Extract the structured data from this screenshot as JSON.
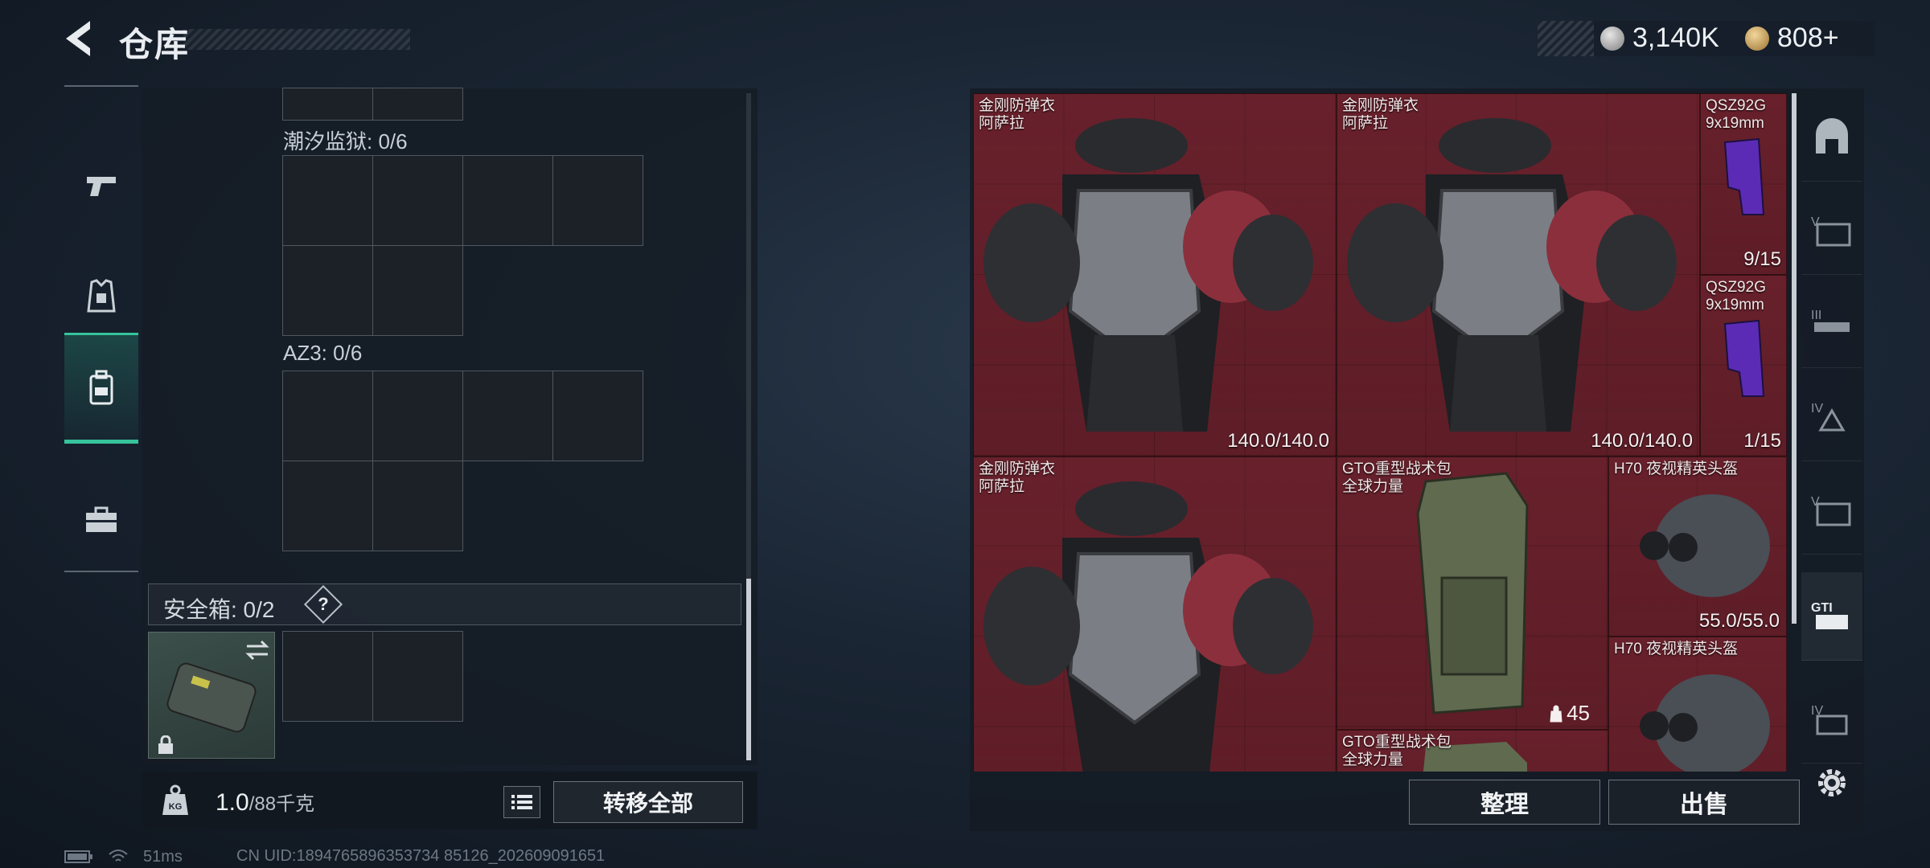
{
  "header": {
    "title": "仓库",
    "currency": {
      "silver": "3,140K",
      "gold": "808",
      "gold_plus": "+"
    }
  },
  "categories": [
    {
      "name": "weapon",
      "icon": "pistol-icon",
      "selected": false
    },
    {
      "name": "armor",
      "icon": "vest-icon",
      "selected": false
    },
    {
      "name": "backpack",
      "icon": "backpack-icon",
      "selected": true
    },
    {
      "name": "tools",
      "icon": "toolbox-icon",
      "selected": false
    }
  ],
  "left_panel": {
    "sections": [
      {
        "label": "潮汐监狱: 0/6"
      },
      {
        "label": "AZ3: 0/6"
      }
    ],
    "safebox": {
      "label": "安全箱: 0/2",
      "help": "?"
    },
    "weight": {
      "current": "1.0",
      "capacity": "/88千克"
    },
    "transfer_all": "转移全部"
  },
  "status": {
    "ping": "51ms",
    "uid": "CN UID:1894765896353734 85126_202609091651"
  },
  "stash_items": [
    {
      "name_line1": "金刚防弹衣",
      "name_line2": "阿萨拉",
      "durability": "140.0/140.0",
      "icon": "body-armor-icon"
    },
    {
      "name_line1": "金刚防弹衣",
      "name_line2": "阿萨拉",
      "durability": "140.0/140.0",
      "icon": "body-armor-icon"
    },
    {
      "name_line1": "QSZ92G",
      "name_line2": "9x19mm",
      "count": "9/15",
      "icon": "ammo-magazine-icon"
    },
    {
      "name_line1": "QSZ92G",
      "name_line2": "9x19mm",
      "count": "1/15",
      "icon": "ammo-magazine-icon"
    },
    {
      "name_line1": "金刚防弹衣",
      "name_line2": "阿萨拉",
      "icon": "body-armor-icon"
    },
    {
      "name_line1": "GTO重型战术包",
      "name_line2": "全球力量",
      "capacity": "45",
      "icon": "backpack-item-icon"
    },
    {
      "name_line1": "H70 夜视精英头盔",
      "durability": "55.0/55.0",
      "icon": "helmet-icon"
    },
    {
      "name_line1": "H70 夜视精英头盔",
      "icon": "helmet-icon"
    },
    {
      "name_line1": "GTO重型战术包",
      "name_line2": "全球力量",
      "icon": "backpack-item-icon"
    }
  ],
  "actions": {
    "sort": "整理",
    "sell": "出售"
  },
  "right_sidebar": [
    {
      "icon": "safe-zone-icon"
    },
    {
      "icon": "tier-v-icon"
    },
    {
      "icon": "tier-iii-icon"
    },
    {
      "icon": "tier-iv-icon"
    },
    {
      "icon": "tier-v-icon"
    },
    {
      "icon": "gti-icon",
      "selected": true
    },
    {
      "icon": "tier-iv-icon"
    }
  ]
}
